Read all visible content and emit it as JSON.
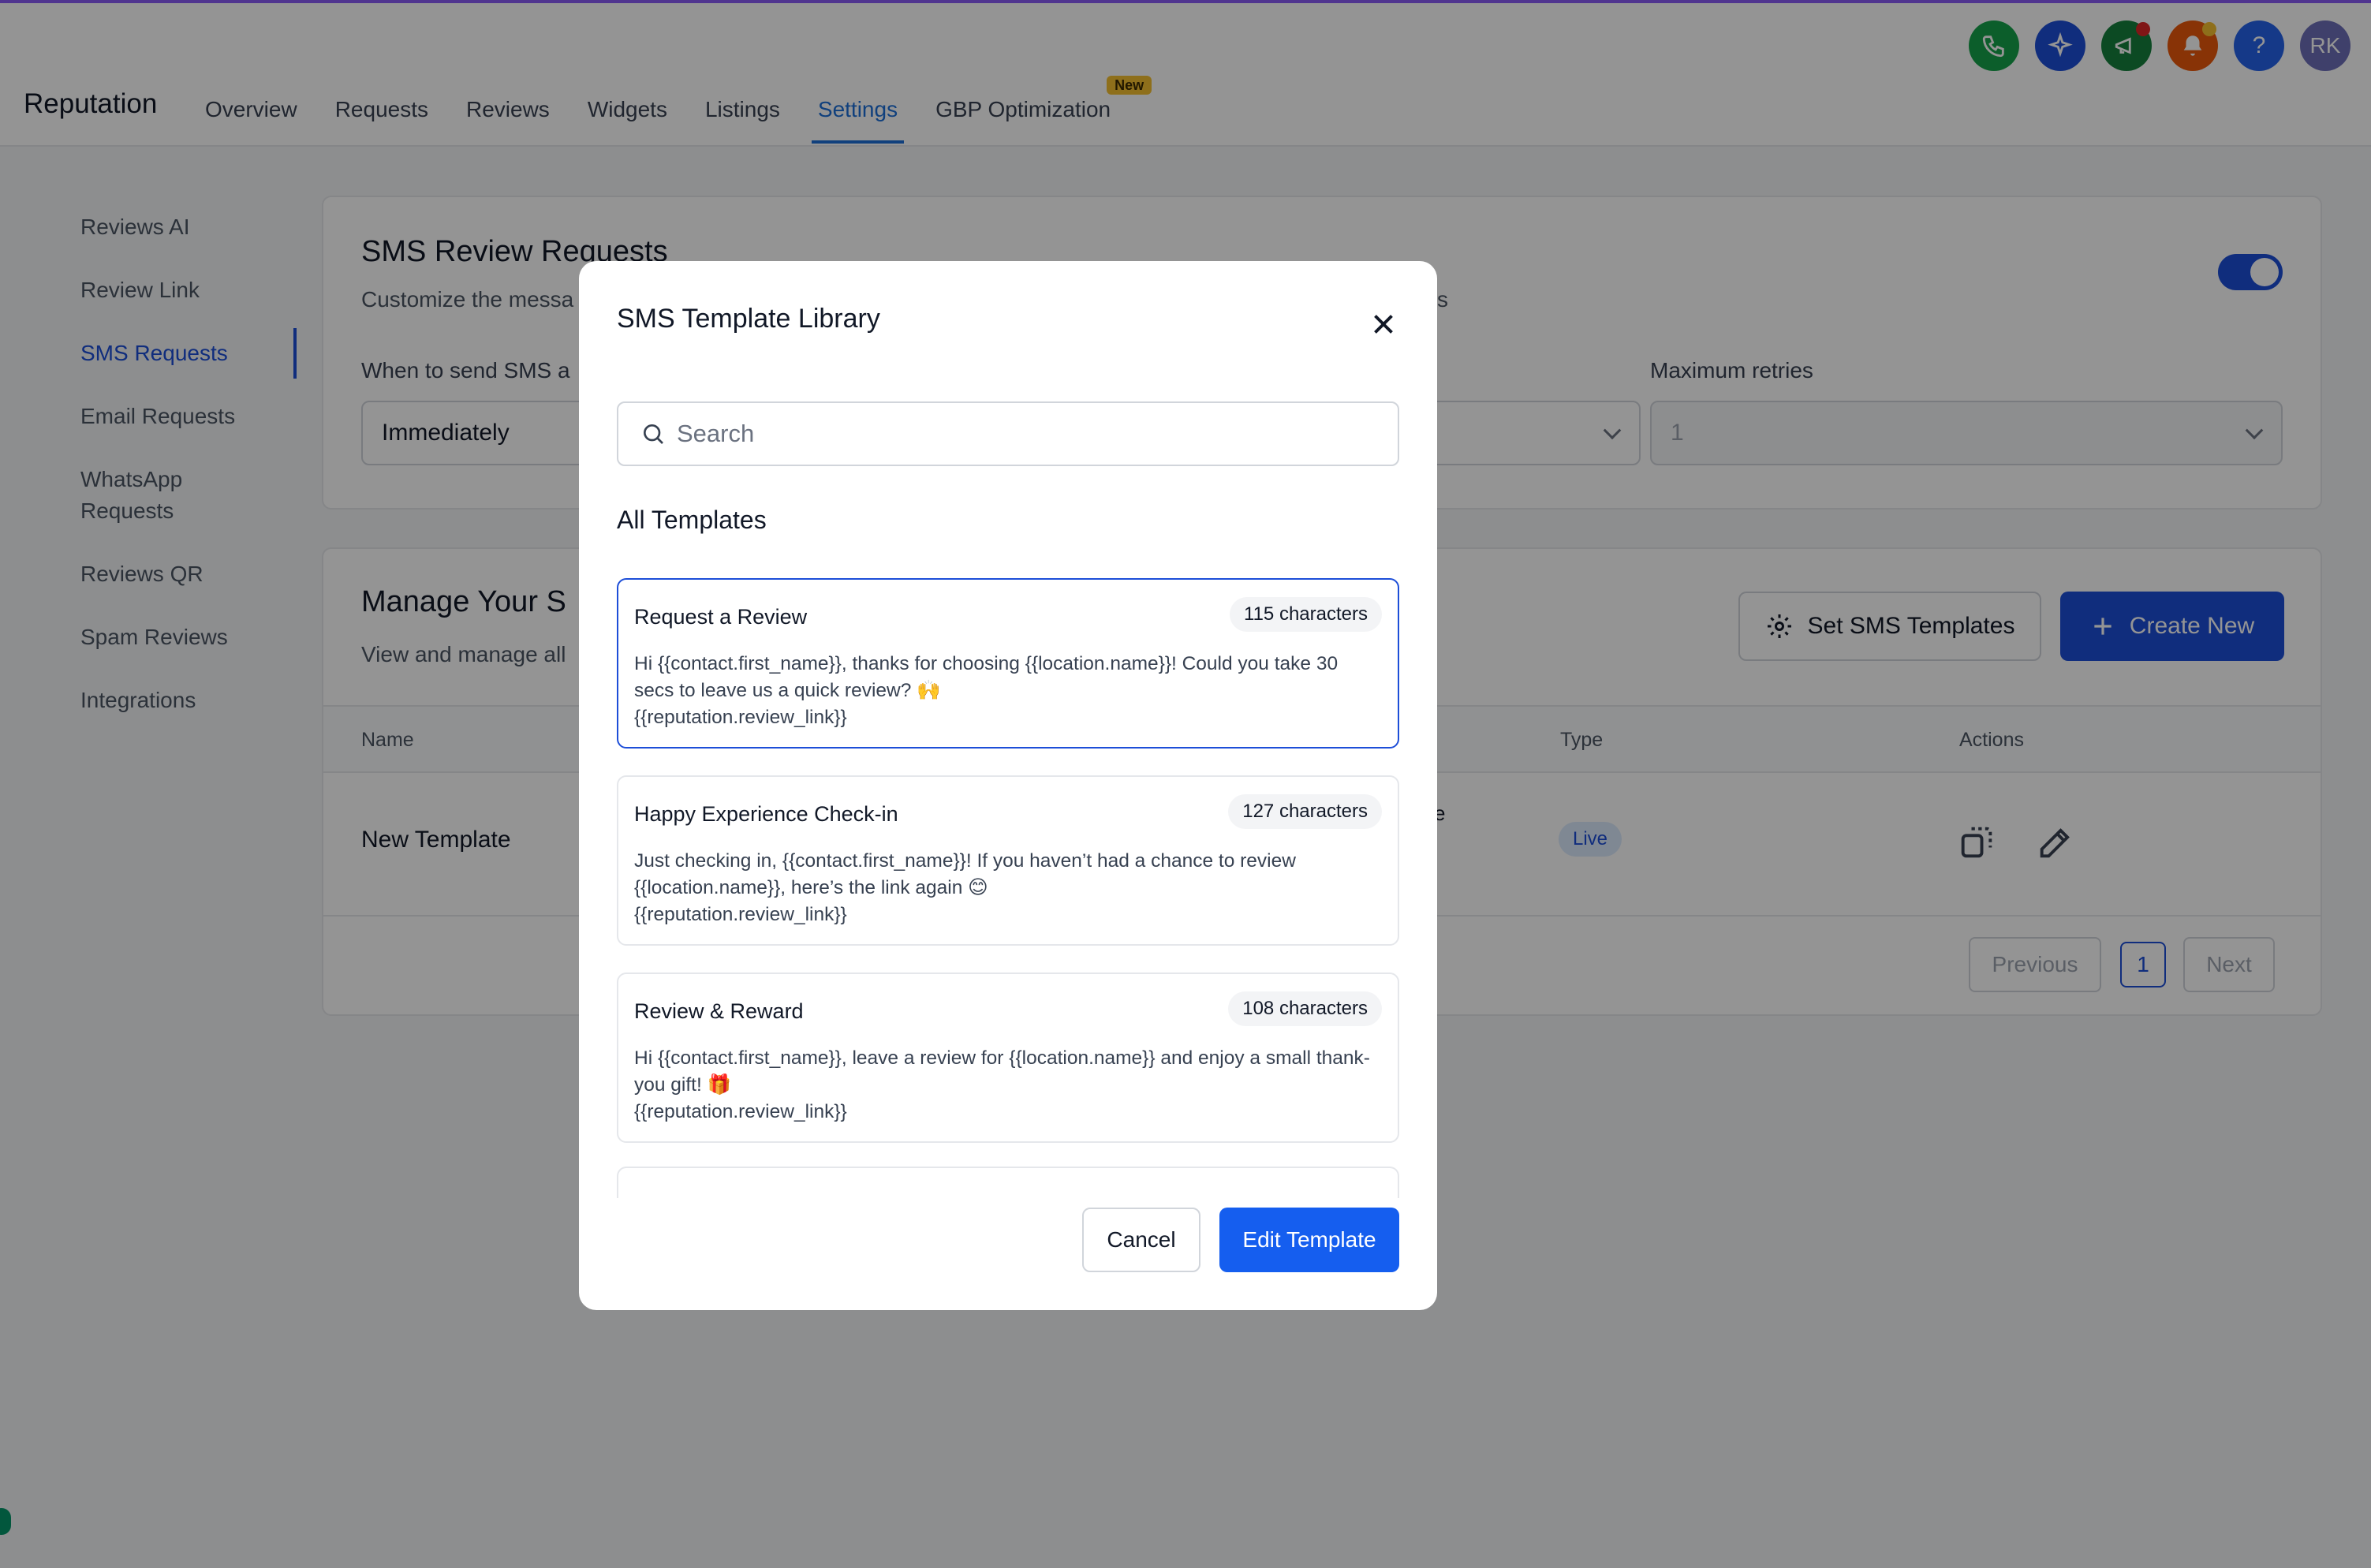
{
  "app": {
    "title": "Reputation"
  },
  "nav": {
    "items": [
      {
        "label": "Overview"
      },
      {
        "label": "Requests"
      },
      {
        "label": "Reviews"
      },
      {
        "label": "Widgets"
      },
      {
        "label": "Listings"
      },
      {
        "label": "Settings",
        "active": true
      },
      {
        "label": "GBP Optimization",
        "badge": "New"
      }
    ]
  },
  "top_icons": {
    "phone": {
      "icon": "phone-icon",
      "color": "#16a34a"
    },
    "ai": {
      "icon": "sparkle-icon",
      "color": "#1d4ed8"
    },
    "announce": {
      "icon": "megaphone-icon",
      "color": "#15803d"
    },
    "notify": {
      "icon": "bell-icon",
      "color": "#ea580c"
    },
    "help": {
      "icon": "help-icon",
      "color": "#2563eb",
      "label": "?"
    },
    "avatar": {
      "label": "RK",
      "color": "#6d6fb8"
    }
  },
  "sidebar": {
    "items": [
      {
        "label": "Reviews AI"
      },
      {
        "label": "Review Link"
      },
      {
        "label": "SMS Requests",
        "active": true
      },
      {
        "label": "Email Requests"
      },
      {
        "label": "WhatsApp Requests"
      },
      {
        "label": "Reviews QR"
      },
      {
        "label": "Spam Reviews"
      },
      {
        "label": "Integrations"
      }
    ]
  },
  "sms_card": {
    "title": "SMS Review Requests",
    "subtitle_visible": "Customize the messa",
    "subtitle_tail": "s",
    "when_label": "When to send SMS a",
    "when_value": "Immediately",
    "max_retries_label": "Maximum retries",
    "max_retries_value": "1",
    "enabled": true
  },
  "manage_card": {
    "title": "Manage Your S",
    "subtitle": "View and manage all",
    "set_templates_label": "Set SMS Templates",
    "create_new_label": "Create New",
    "columns": {
      "name": "Name",
      "type": "Type",
      "actions": "Actions"
    },
    "rows": [
      {
        "name": "New Template",
        "type_fragment": "e",
        "type": "Live"
      }
    ],
    "pager": {
      "previous": "Previous",
      "page": "1",
      "next": "Next"
    }
  },
  "modal": {
    "title": "SMS Template Library",
    "search_placeholder": "Search",
    "section_heading": "All Templates",
    "templates": [
      {
        "name": "Request a Review",
        "count": "115 characters",
        "body": "Hi {{contact.first_name}}, thanks for choosing {{location.name}}! Could you take 30 secs to leave us a quick review? 🙌\n{{reputation.review_link}}",
        "selected": true
      },
      {
        "name": "Happy Experience Check-in",
        "count": "127 characters",
        "body": "Just checking in, {{contact.first_name}}! If you haven’t had a chance to review {{location.name}}, here’s the link again 😊\n{{reputation.review_link}}"
      },
      {
        "name": "Review & Reward",
        "count": "108 characters",
        "body": "Hi {{contact.first_name}}, leave a review for {{location.name}} and enjoy a small thank-you gift! 🎁\n{{reputation.review_link}}"
      }
    ],
    "cancel_label": "Cancel",
    "edit_label": "Edit Template"
  }
}
